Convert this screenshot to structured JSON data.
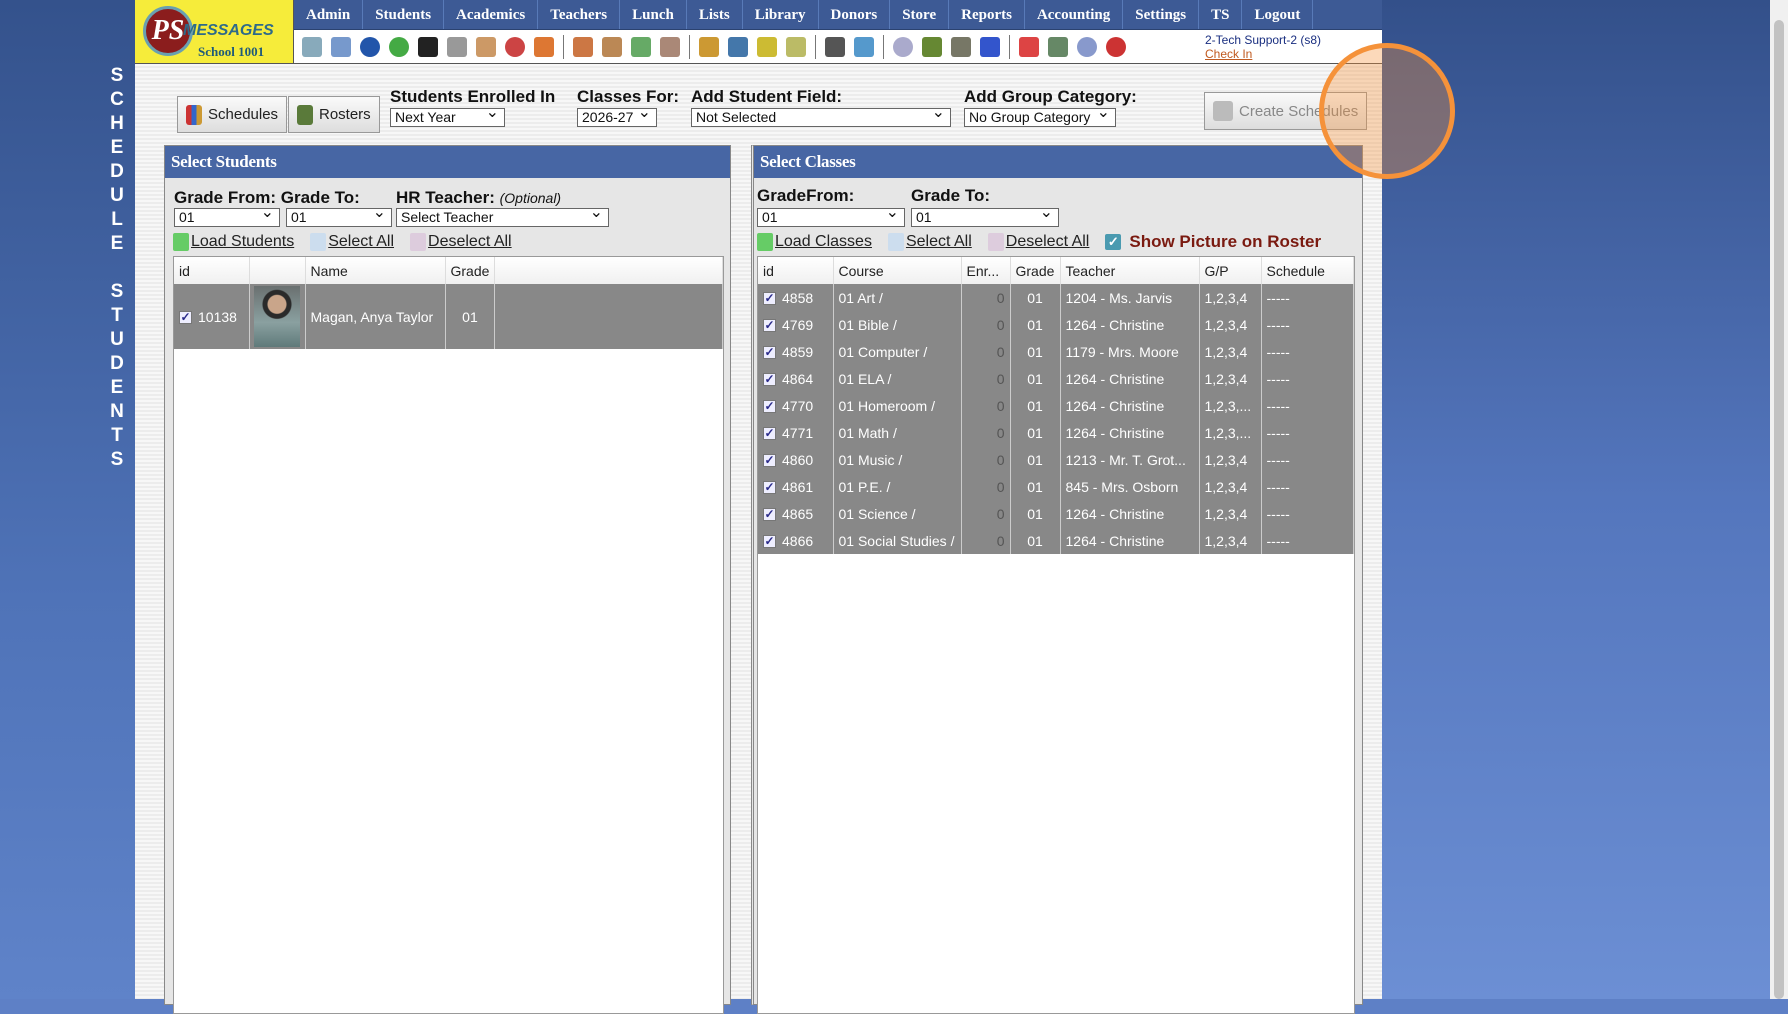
{
  "side_title": "SCHEDULE STUDENTS",
  "logo": {
    "initials": "PS",
    "brand": "MESSAGES",
    "school": "School 1001"
  },
  "nav": [
    "Admin",
    "Students",
    "Academics",
    "Teachers",
    "Lunch",
    "Lists",
    "Library",
    "Donors",
    "Store",
    "Reports",
    "Accounting",
    "Settings",
    "TS",
    "Logout"
  ],
  "toolbar_icons": [
    "search-icon",
    "calendar-grid-icon",
    "email-at-icon",
    "chat-icon",
    "phone-icon",
    "speaker-icon",
    "calendar-icon",
    "date-icon",
    "megaphone-icon",
    "|",
    "add-user-icon",
    "user-icon",
    "money-icon",
    "users-icon",
    "|",
    "lunch-icon",
    "book-icon",
    "bell-icon",
    "export-icon",
    "|",
    "staff-icon",
    "clock-icon",
    "|",
    "calculator-icon",
    "card-icon",
    "printer-icon",
    "ap-icon",
    "|",
    "pdf-icon",
    "cash-register-icon",
    "help-icon",
    "power-icon"
  ],
  "user": {
    "name": "2-Tech Support-2 (s8)",
    "check_in": "Check In"
  },
  "controls": {
    "schedules": "Schedules",
    "rosters": "Rosters",
    "enrolled_label": "Students Enrolled In",
    "enrolled_value": "Next Year",
    "classes_for_label": "Classes For:",
    "classes_for_value": "2026-27",
    "student_field_label": "Add Student Field:",
    "student_field_value": "Not Selected",
    "group_label": "Add Group Category:",
    "group_value": "No Group Category",
    "create": "Create Schedules"
  },
  "students": {
    "title": "Select Students",
    "grade_from_label": "Grade From:",
    "grade_to_label": "Grade To:",
    "hr_label": "HR Teacher:",
    "hr_optional": "(Optional)",
    "grade_from": "01",
    "grade_to": "01",
    "teacher": "Select Teacher",
    "load": "Load Students",
    "select_all": "Select All",
    "deselect_all": "Deselect All",
    "columns": [
      "id",
      "",
      "Name",
      "Grade",
      ""
    ],
    "rows": [
      {
        "id": "10138",
        "name": "Magan, Anya Taylor",
        "grade": "01",
        "checked": true
      }
    ]
  },
  "classes": {
    "title": "Select Classes",
    "grade_from_label": "GradeFrom:",
    "grade_to_label": "Grade To:",
    "grade_from": "01",
    "grade_to": "01",
    "load": "Load Classes",
    "select_all": "Select All",
    "deselect_all": "Deselect All",
    "show_picture": "Show Picture on Roster",
    "show_picture_checked": true,
    "columns": [
      "id",
      "Course",
      "Enr...",
      "Grade",
      "Teacher",
      "G/P",
      "Schedule"
    ],
    "rows": [
      [
        "4858",
        "01 Art /",
        "0",
        "01",
        "1204 - Ms. Jarvis",
        "1,2,3,4",
        "-----"
      ],
      [
        "4769",
        "01 Bible /",
        "0",
        "01",
        "1264 - Christine",
        "1,2,3,4",
        "-----"
      ],
      [
        "4859",
        "01 Computer /",
        "0",
        "01",
        "1179 - Mrs. Moore",
        "1,2,3,4",
        "-----"
      ],
      [
        "4864",
        "01 ELA /",
        "0",
        "01",
        "1264 - Christine",
        "1,2,3,4",
        "-----"
      ],
      [
        "4770",
        "01 Homeroom /",
        "0",
        "01",
        "1264 - Christine",
        "1,2,3,...",
        "-----"
      ],
      [
        "4771",
        "01 Math /",
        "0",
        "01",
        "1264 - Christine",
        "1,2,3,...",
        "-----"
      ],
      [
        "4860",
        "01 Music /",
        "0",
        "01",
        "1213 - Mr. T. Grot...",
        "1,2,3,4",
        "-----"
      ],
      [
        "4861",
        "01 P.E. /",
        "0",
        "01",
        "845 - Mrs. Osborn",
        "1,2,3,4",
        "-----"
      ],
      [
        "4865",
        "01 Science /",
        "0",
        "01",
        "1264 - Christine",
        "1,2,3,4",
        "-----"
      ],
      [
        "4866",
        "01 Social Studies /",
        "0",
        "01",
        "1264 - Christine",
        "1,2,3,4",
        "-----"
      ]
    ]
  },
  "colors": {
    "nav": "#3d5a95",
    "panel_header": "#4766a4",
    "row": "#888888",
    "highlight": "#f5923a",
    "logo_bg": "#f6ec3a"
  }
}
